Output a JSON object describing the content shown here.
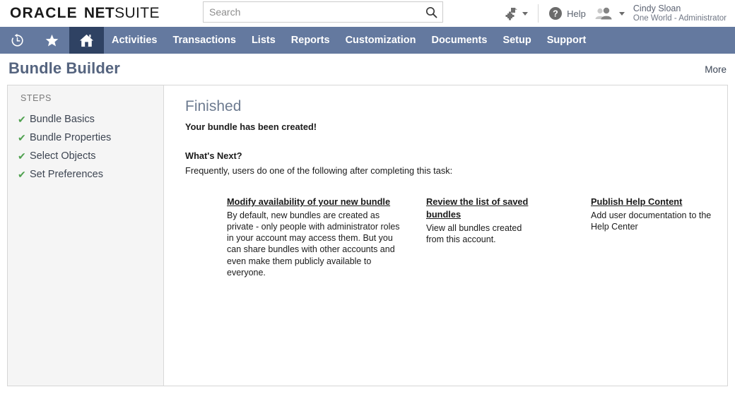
{
  "header": {
    "logo": {
      "oracle": "ORACLE",
      "net": "NET",
      "suite": "SUITE"
    },
    "search": {
      "placeholder": "Search",
      "value": "",
      "icon": "search-icon"
    },
    "quick_add_icon": "quick-add-icon",
    "help": {
      "label": "Help",
      "icon": "help-circle-icon"
    },
    "user": {
      "name": "Cindy Sloan",
      "role": "One World - Administrator",
      "icon": "user-avatar-icon"
    }
  },
  "nav": {
    "icons": [
      {
        "name": "recent-history-icon",
        "label": "Recent Records"
      },
      {
        "name": "favorites-star-icon",
        "label": "Shortcuts"
      },
      {
        "name": "home-icon",
        "label": "Home",
        "active": true
      }
    ],
    "items": [
      {
        "label": "Activities"
      },
      {
        "label": "Transactions"
      },
      {
        "label": "Lists"
      },
      {
        "label": "Reports"
      },
      {
        "label": "Customization"
      },
      {
        "label": "Documents"
      },
      {
        "label": "Setup"
      },
      {
        "label": "Support"
      }
    ]
  },
  "page": {
    "title": "Bundle Builder",
    "more_label": "More"
  },
  "sidebar": {
    "title": "STEPS",
    "check_glyph": "✔",
    "steps": [
      {
        "label": "Bundle Basics",
        "completed": true
      },
      {
        "label": "Bundle Properties",
        "completed": true
      },
      {
        "label": "Select Objects",
        "completed": true
      },
      {
        "label": "Set Preferences",
        "completed": true
      }
    ]
  },
  "main": {
    "heading": "Finished",
    "confirmation": "Your bundle has been created!",
    "whats_next_title": "What's Next?",
    "whats_next_desc": "Frequently, users do one of the following after completing this task:",
    "cards": [
      {
        "link": "Modify availability of your new bundle",
        "body": "By default, new bundles are created as private - only people\nwith administrator roles in your account may access them.\nBut you can share bundles with other accounts and even\nmake them publicly available to everyone."
      },
      {
        "link": "Review the list of saved bundles",
        "body": "View all bundles created from this account."
      },
      {
        "link": "Publish Help Content",
        "body": "Add user documentation to the Help Center"
      }
    ]
  },
  "colors": {
    "nav_bar": "#64799f",
    "nav_active": "#2f4263",
    "title_blue": "#55647f",
    "check_green": "#4fa14f",
    "sidebar_bg": "#f5f5f5"
  }
}
